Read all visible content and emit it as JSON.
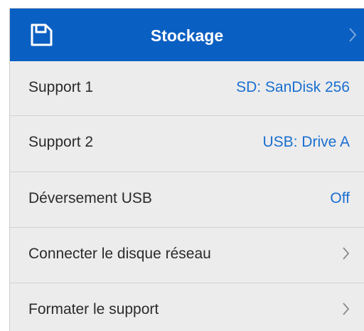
{
  "header": {
    "title": "Stockage",
    "icon": "save-disk-icon",
    "accent_color": "#0a5fc2"
  },
  "rows": [
    {
      "label": "Support 1",
      "value": "SD: SanDisk 256"
    },
    {
      "label": "Support 2",
      "value": "USB: Drive A"
    },
    {
      "label": "Déversement USB",
      "value": "Off"
    },
    {
      "label": "Connecter le disque réseau",
      "icon": "chevron-right-icon"
    },
    {
      "label": "Formater le support",
      "icon": "chevron-right-icon"
    }
  ],
  "value_color": "#1a6fd0"
}
